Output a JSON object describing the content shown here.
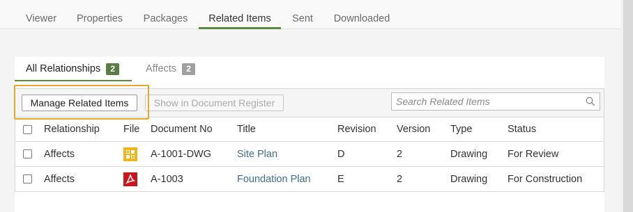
{
  "top_tabs": [
    "Viewer",
    "Properties",
    "Packages",
    "Related Items",
    "Sent",
    "Downloaded"
  ],
  "active_top_tab": "Related Items",
  "sub_tabs": {
    "all": {
      "label": "All Relationships",
      "count": "2"
    },
    "affects": {
      "label": "Affects",
      "count": "2"
    }
  },
  "toolbar": {
    "manage_label": "Manage Related Items",
    "show_label": "Show in Document Register",
    "search_placeholder": "Search Related Items"
  },
  "table": {
    "headers": [
      "Relationship",
      "File",
      "Document No",
      "Title",
      "Revision",
      "Version",
      "Type",
      "Status"
    ],
    "rows": [
      {
        "relationship": "Affects",
        "file_icon": "drawing-file-icon",
        "doc_no": "A-1001-DWG",
        "title": "Site Plan",
        "revision": "D",
        "version": "2",
        "type": "Drawing",
        "status": "For Review"
      },
      {
        "relationship": "Affects",
        "file_icon": "pdf-file-icon",
        "doc_no": "A-1003",
        "title": "Foundation Plan",
        "revision": "E",
        "version": "2",
        "type": "Drawing",
        "status": "For Construction"
      }
    ]
  },
  "colors": {
    "accent_green": "#5a8a3a",
    "highlight_orange": "#e8a92a",
    "link_blue": "#3e6f91",
    "drawing_icon": "#f2b418",
    "pdf_icon": "#c8161d"
  }
}
